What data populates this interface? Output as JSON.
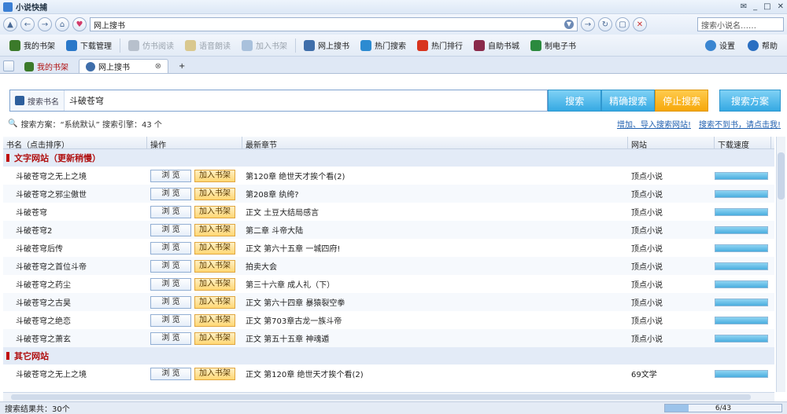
{
  "app": {
    "title": "小说快捕"
  },
  "address": {
    "url": "网上搜书",
    "site_search_placeholder": "搜索小说名……"
  },
  "toolbar": {
    "items": [
      {
        "label": "我的书架",
        "icon": "bookshelf-icon",
        "color": "#3b7a2a",
        "disabled": false
      },
      {
        "label": "下载管理",
        "icon": "download-icon",
        "color": "#2a78c9",
        "disabled": false
      },
      {
        "label": "仿书阅读",
        "icon": "read-icon",
        "color": "#b7c0cc",
        "disabled": true
      },
      {
        "label": "语音朗读",
        "icon": "voice-icon",
        "color": "#d9c88f",
        "disabled": true
      },
      {
        "label": "加入书架",
        "icon": "add-shelf-icon",
        "color": "#a9c1dc",
        "disabled": true
      },
      {
        "label": "网上搜书",
        "icon": "web-search-icon",
        "color": "#3f6eaa",
        "disabled": false
      },
      {
        "label": "热门搜索",
        "icon": "hot-search-icon",
        "color": "#2c8bd1",
        "disabled": false
      },
      {
        "label": "热门排行",
        "icon": "hot-rank-icon",
        "color": "#d8341e",
        "disabled": false
      },
      {
        "label": "自助书城",
        "icon": "bookstore-icon",
        "color": "#8a2a4a",
        "disabled": false
      },
      {
        "label": "制电子书",
        "icon": "ebook-icon",
        "color": "#2b8a3e",
        "disabled": false
      }
    ],
    "settings": "设置",
    "help": "帮助"
  },
  "tabs": [
    {
      "label": "我的书架",
      "active": false
    },
    {
      "label": "网上搜书",
      "active": true
    }
  ],
  "search": {
    "label": "搜索书名",
    "value": "斗破苍穹",
    "btn_search": "搜索",
    "btn_exact": "精确搜索",
    "btn_stop": "停止搜索",
    "btn_scheme": "搜索方案"
  },
  "info": {
    "text": "搜索方案：“系统默认” 搜索引擎：43 个",
    "link_add": "增加、导入搜索网站!",
    "link_request": "搜索不到书，请点击我!"
  },
  "columns": [
    "书名（点击排序）",
    "操作",
    "最新章节",
    "网站",
    "下载速度"
  ],
  "buttons": {
    "view": "浏 览",
    "add": "加入书架"
  },
  "groups": [
    {
      "title": "文字网站（更新稍慢）",
      "rows": [
        {
          "name": "斗破苍穹之无上之境",
          "chapter": "第120章 绝世天才挨个看(2)",
          "site": "顶点小说",
          "speed": 1.0
        },
        {
          "name": "斗破苍穹之邪尘傲世",
          "chapter": "第208章 纨绔?",
          "site": "顶点小说",
          "speed": 1.0
        },
        {
          "name": "斗破苍穹",
          "chapter": "正文 土豆大结局感言",
          "site": "顶点小说",
          "speed": 1.0
        },
        {
          "name": "斗破苍穹2",
          "chapter": "第二章 斗帝大陆",
          "site": "顶点小说",
          "speed": 1.0
        },
        {
          "name": "斗破苍穹后传",
          "chapter": "正文 第六十五章 一城四府!",
          "site": "顶点小说",
          "speed": 1.0
        },
        {
          "name": "斗破苍穹之首位斗帝",
          "chapter": "拍卖大会",
          "site": "顶点小说",
          "speed": 1.0
        },
        {
          "name": "斗破苍穹之药尘",
          "chapter": "第三十六章 成人礼（下）",
          "site": "顶点小说",
          "speed": 1.0
        },
        {
          "name": "斗破苍穹之古昊",
          "chapter": "正文 第六十四章 暴猿裂空拳",
          "site": "顶点小说",
          "speed": 1.0
        },
        {
          "name": "斗破苍穹之绝恋",
          "chapter": "正文 第703章古龙一族斗帝",
          "site": "顶点小说",
          "speed": 1.0
        },
        {
          "name": "斗破苍穹之萧玄",
          "chapter": "正文 第五十五章 神魂遁",
          "site": "顶点小说",
          "speed": 1.0
        }
      ]
    },
    {
      "title": "其它网站",
      "rows": [
        {
          "name": "斗破苍穹之无上之境",
          "chapter": "正文 第120章 绝世天才挨个看(2)",
          "site": "69文学",
          "speed": 1.0
        }
      ]
    }
  ],
  "status": {
    "result": "搜索结果共：30个",
    "pages": "6/43"
  }
}
